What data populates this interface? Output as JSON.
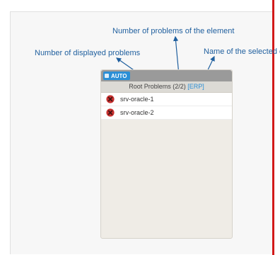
{
  "annotations": {
    "problems_of_element": "Number of problems of the element",
    "displayed_problems": "Number of displayed problems",
    "selected_element_name": "Name of  the selected e"
  },
  "panel": {
    "auto_label": "AUTO",
    "header_title": "Root Problems (2/2)",
    "context_tag": "[ERP]",
    "rows": [
      {
        "name": "srv-oracle-1",
        "status_icon": "error-circle-icon"
      },
      {
        "name": "srv-oracle-2",
        "status_icon": "error-circle-icon"
      }
    ]
  },
  "colors": {
    "annotation": "#1f5f9e",
    "accent": "#2b8fd6",
    "error": "#c8312f",
    "right_border": "#d21a1a"
  }
}
